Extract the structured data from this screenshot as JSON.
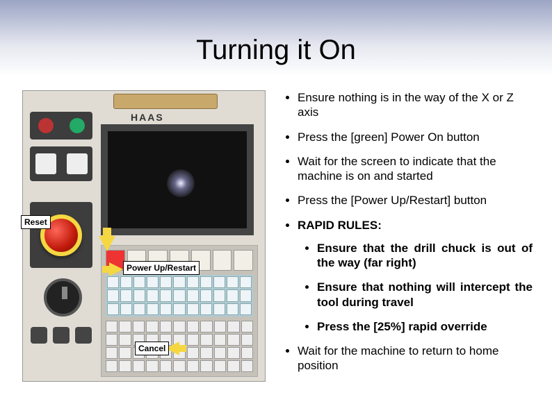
{
  "title": "Turning it On",
  "image": {
    "brand": "HAAS",
    "callouts": {
      "reset": "Reset",
      "power_up": "Power Up/Restart",
      "cancel": "Cancel"
    }
  },
  "bullets": {
    "b1": "Ensure nothing is in the way of the X or Z axis",
    "b2": "Press the [green] Power On button",
    "b3": "Wait for the screen to indicate that the machine is on and started",
    "b4": "Press the [Power Up/Restart] button",
    "b5": "RAPID RULES:",
    "sub1": "Ensure that the drill chuck is out of the way (far right)",
    "sub2": "Ensure that nothing will intercept the tool during travel",
    "sub3": "Press the [25%] rapid override",
    "b6": "Wait for the machine to return to home position"
  }
}
